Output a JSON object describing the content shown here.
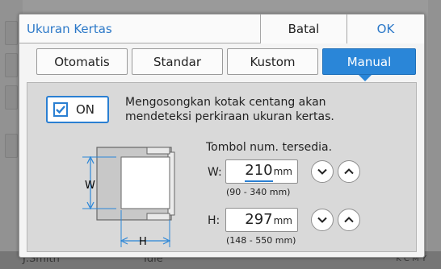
{
  "background": {
    "user": "J.Smith",
    "status": "Idle",
    "toner": "K C M Y"
  },
  "dialog": {
    "title": "Ukuran Kertas",
    "cancel_label": "Batal",
    "ok_label": "OK"
  },
  "tabs": [
    {
      "label": "Otomatis",
      "active": false
    },
    {
      "label": "Standar",
      "active": false
    },
    {
      "label": "Kustom",
      "active": false
    },
    {
      "label": "Manual",
      "active": true
    }
  ],
  "manual": {
    "on_label": "ON",
    "on_checked": true,
    "description_line1": "Mengosongkan kotak centang akan",
    "description_line2": "mendeteksi perkiraan ukuran kertas.",
    "hint": "Tombol num. tersedia.",
    "diagram": {
      "w_label": "W",
      "h_label": "H"
    },
    "width": {
      "label": "W:",
      "value": "210",
      "unit": "mm",
      "range": "(90 - 340 mm)"
    },
    "height": {
      "label": "H:",
      "value": "297",
      "unit": "mm",
      "range": "(148 - 550 mm)"
    }
  },
  "icons": {
    "check": "check-icon",
    "decrement": "chevron-down-icon",
    "increment": "chevron-up-icon"
  },
  "colors": {
    "accent": "#2a86d8",
    "title_text": "#2b78c8"
  }
}
